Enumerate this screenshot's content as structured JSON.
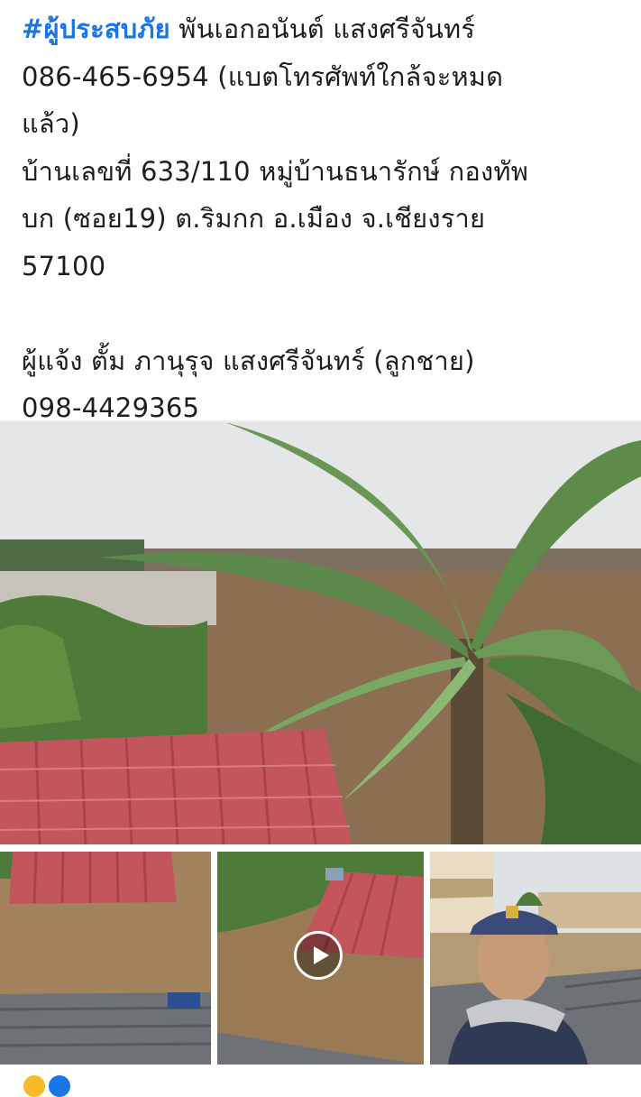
{
  "post": {
    "hashtag": "#ผู้ประสบภัย",
    "line1_rest": " พันเอกอนันต์ แสงศรีจันทร์",
    "line2": "086-465-6954 (แบตโทรศัพท์ใกล้จะหมด",
    "line3": "แล้ว)",
    "line4": "บ้านเลขที่ 633/110 หมู่บ้านธนารักษ์ กองทัพ",
    "line5": "บก (ซอย19) ต.ริมกก อ.เมือง จ.เชียงราย",
    "line6": "57100",
    "line7": "ผู้แจ้ง ตั้ม ภานุรุจ แสงศรีจันทร์ (ลูกชาย)",
    "line8": "098-4429365"
  },
  "colors": {
    "hashtag": "#1b74e4",
    "text": "#1c1e21",
    "flood_water": "#9a7a55",
    "roof_red": "#c3565d",
    "roof_gray": "#6e7276"
  },
  "media": {
    "main_photo": "flooded-house-with-coconut-palm",
    "thumbnails": [
      "flooded-roof-photo",
      "flooded-roof-video",
      "man-on-rooftop-photo"
    ],
    "play_icon": "play-icon"
  }
}
